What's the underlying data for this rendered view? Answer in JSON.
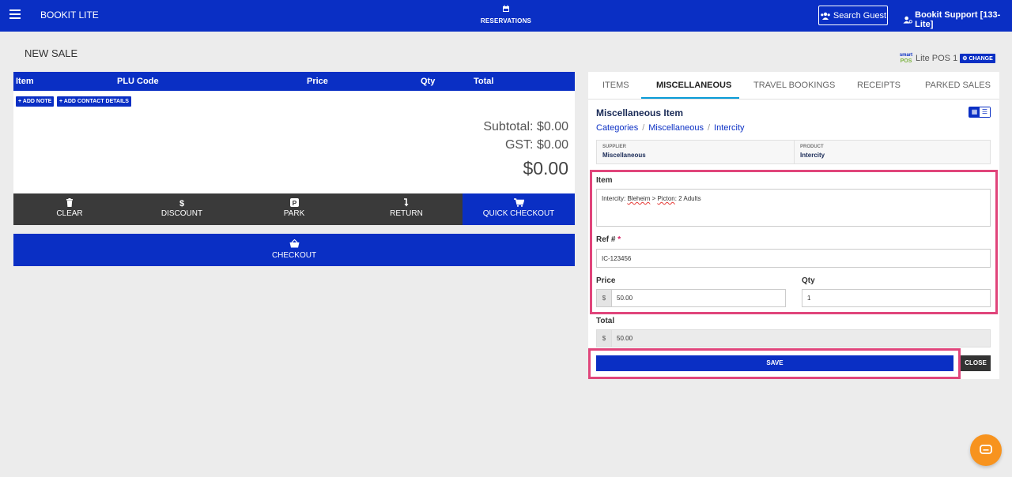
{
  "topbar": {
    "app_title": "BOOKIT LITE",
    "reservations_label": "RESERVATIONS",
    "search_guest_label": "Search Guest",
    "user_label": "Bookit Support [133-Lite]"
  },
  "page": {
    "title": "NEW SALE"
  },
  "pos": {
    "logo_top": "smart",
    "logo_bottom": "POS",
    "name": "Lite POS 1",
    "change_label": "CHANGE"
  },
  "cart": {
    "columns": [
      "Item",
      "PLU Code",
      "Price",
      "Qty",
      "Total"
    ],
    "add_note_label": "ADD NOTE",
    "add_contact_label": "ADD CONTACT DETAILS",
    "subtotal_label": "Subtotal:",
    "subtotal_value": "$0.00",
    "gst_label": "GST:",
    "gst_value": "$0.00",
    "total_value": "$0.00"
  },
  "actions": {
    "clear": "CLEAR",
    "discount": "DISCOUNT",
    "park": "PARK",
    "return": "RETURN",
    "quick_checkout": "QUICK CHECKOUT",
    "checkout": "CHECKOUT"
  },
  "tabs": [
    "ITEMS",
    "MISCELLANEOUS",
    "TRAVEL BOOKINGS",
    "RECEIPTS",
    "PARKED SALES"
  ],
  "misc": {
    "title": "Miscellaneous Item",
    "breadcrumbs": [
      "Categories",
      "Miscellaneous",
      "Intercity"
    ],
    "supplier_label": "SUPPLIER",
    "supplier_value": "Miscellaneous",
    "product_label": "PRODUCT",
    "product_value": "Intercity"
  },
  "form": {
    "item_label": "Item",
    "item_value_pre": "Intercity: ",
    "item_value_w1": "Bleheim",
    "item_value_mid": " > ",
    "item_value_w2": "Picton",
    "item_value_post": ": 2 Adults",
    "ref_label": "Ref #",
    "ref_required": "*",
    "ref_value": "IC-123456",
    "price_label": "Price",
    "currency": "$",
    "price_value": "50.00",
    "qty_label": "Qty",
    "qty_value": "1",
    "total_label": "Total",
    "total_value": "50.00",
    "save_label": "SAVE",
    "close_label": "CLOSE"
  },
  "colors": {
    "primary": "#0a2fc4",
    "highlight": "#e0457b",
    "accent_tab": "#0a9cd7",
    "chat": "#f7931e"
  }
}
